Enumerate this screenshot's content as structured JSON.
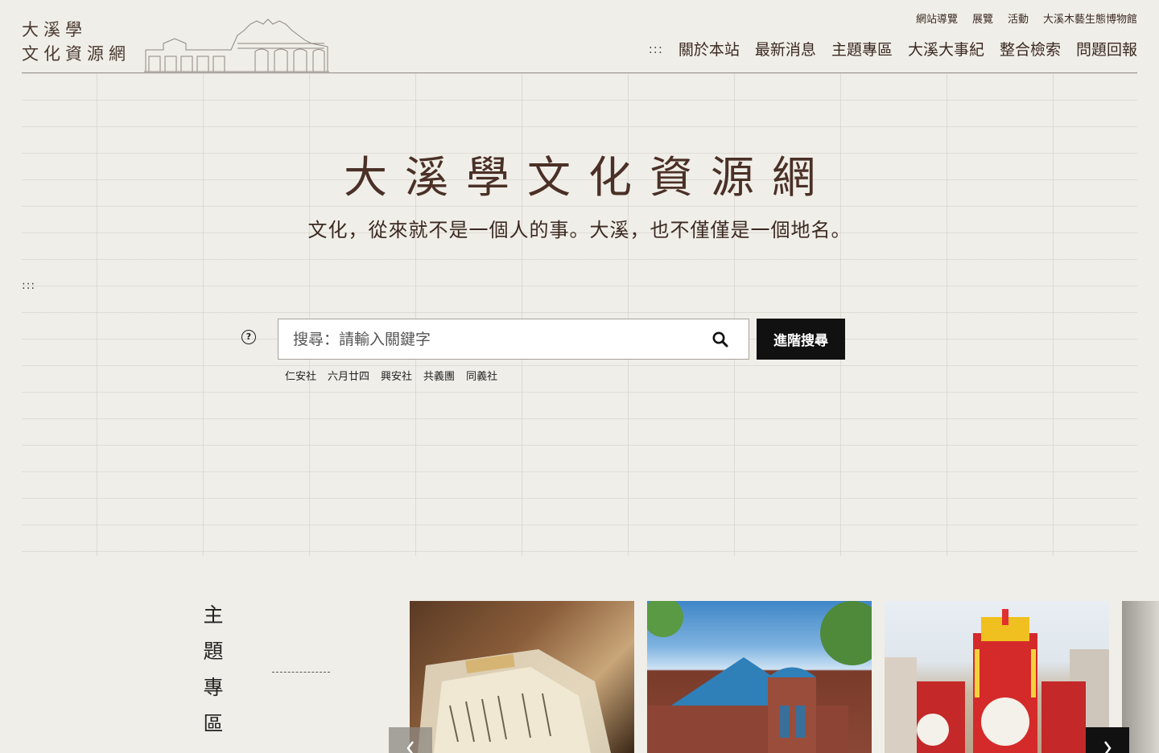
{
  "logo": {
    "line1": "大溪學",
    "line2": "文化資源網"
  },
  "util_nav": [
    "網站導覽",
    "展覽",
    "活動",
    "大溪木藝生態博物館"
  ],
  "main_nav": {
    "accesskey": ":::",
    "items": [
      "關於本站",
      "最新消息",
      "主題專區",
      "大溪大事紀",
      "整合檢索",
      "問題回報"
    ]
  },
  "hero": {
    "title": "大溪學文化資源網",
    "subtitle": "文化，從來就不是一個人的事。大溪，也不僅僅是一個地名。",
    "accesskey": ":::"
  },
  "search": {
    "placeholder": "搜尋：請輸入關鍵字",
    "advanced_label": "進階搜尋",
    "tags": [
      "仁安社",
      "六月廿四",
      "興安社",
      "共義團",
      "同義社"
    ]
  },
  "topics": {
    "title": "主題專區"
  },
  "icons": [
    "help-icon",
    "search-icon",
    "chevron-left-icon",
    "chevron-right-icon"
  ]
}
